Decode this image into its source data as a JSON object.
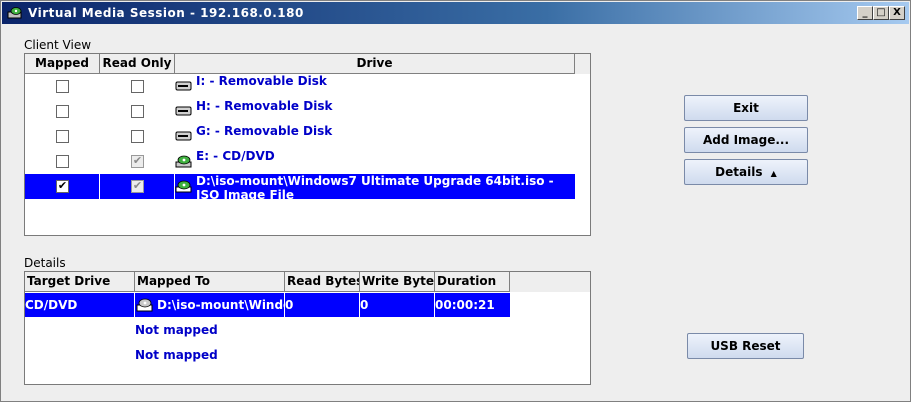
{
  "window": {
    "title": "Virtual Media Session - 192.168.0.180",
    "minimize": "_",
    "maximize": "□",
    "close": "X"
  },
  "client_view": {
    "label": "Client View",
    "columns": [
      "Mapped",
      "Read Only",
      "Drive"
    ],
    "rows": [
      {
        "mapped": false,
        "read_only": false,
        "read_only_disabled": false,
        "drive": "I: - Removable Disk",
        "icon": "removable-disk-icon",
        "selected": false
      },
      {
        "mapped": false,
        "read_only": false,
        "read_only_disabled": false,
        "drive": "H: - Removable Disk",
        "icon": "removable-disk-icon",
        "selected": false
      },
      {
        "mapped": false,
        "read_only": false,
        "read_only_disabled": false,
        "drive": "G: - Removable Disk",
        "icon": "removable-disk-icon",
        "selected": false
      },
      {
        "mapped": false,
        "read_only": true,
        "read_only_disabled": true,
        "drive": "E: - CD/DVD",
        "icon": "cd-dvd-icon",
        "selected": false
      },
      {
        "mapped": true,
        "read_only": true,
        "read_only_disabled": true,
        "drive": "D:\\iso-mount\\Windows7 Ultimate Upgrade 64bit.iso - ISO Image File",
        "icon": "iso-image-icon",
        "selected": true
      }
    ]
  },
  "details": {
    "label": "Details",
    "columns": [
      "Target Drive",
      "Mapped To",
      "Read Bytes",
      "Write Bytes",
      "Duration"
    ],
    "rows": [
      {
        "target": "CD/DVD",
        "mapped_to": "D:\\iso-mount\\Windo...",
        "read_bytes": "0",
        "write_bytes": "0",
        "duration": "00:00:21"
      }
    ],
    "not_mapped": [
      "Not mapped",
      "Not mapped"
    ]
  },
  "buttons": {
    "exit": "Exit",
    "add_image": "Add Image...",
    "details": "Details",
    "details_arrow": "▲",
    "usb_reset": "USB Reset"
  },
  "colors": {
    "selection": "#0000ff",
    "drive_text": "#0000c8",
    "title_bar": "#0a246a"
  }
}
